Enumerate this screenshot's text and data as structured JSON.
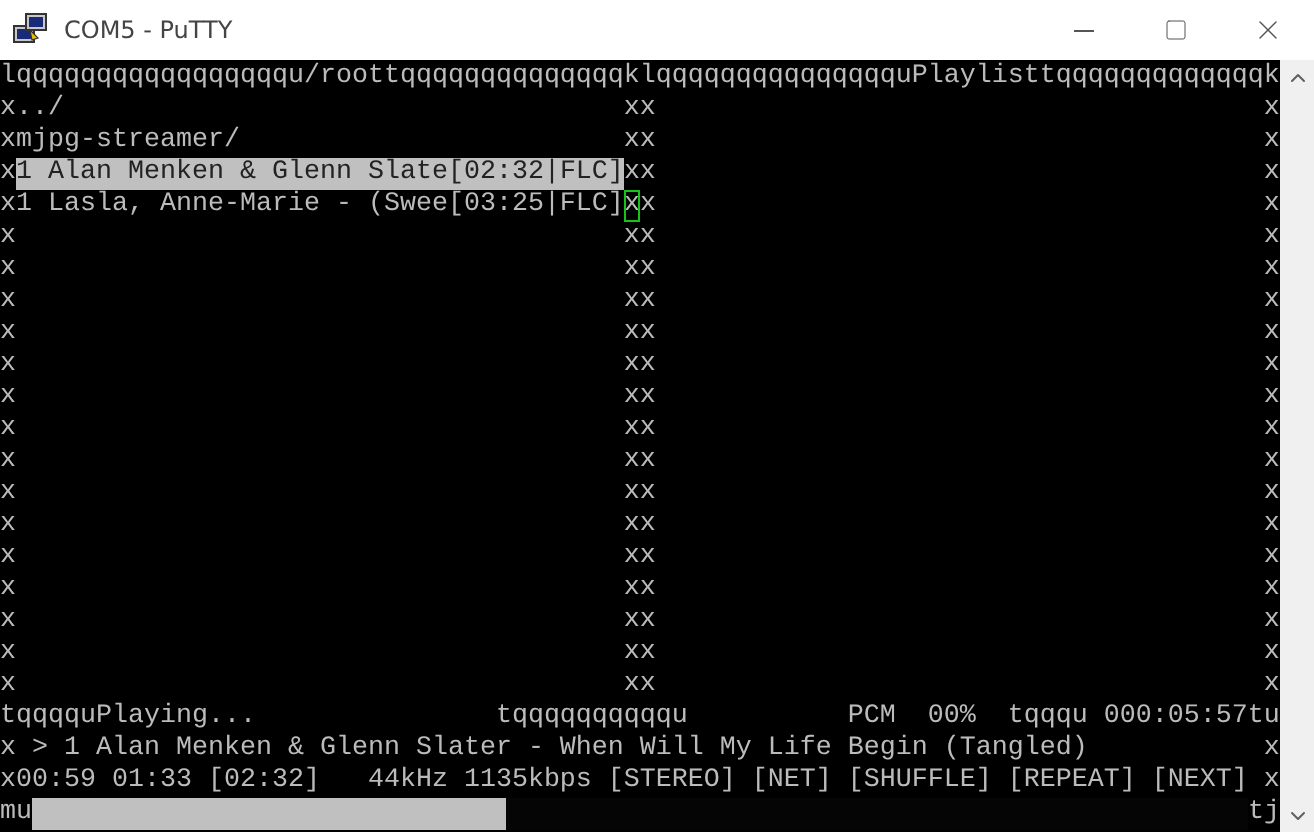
{
  "window": {
    "title": "COM5 - PuTTY"
  },
  "terminal": {
    "lines": [
      [
        {
          "kind": "text",
          "text": "lqqqqqqqqqqqqqqqqqu/roottqqqqqqqqqqqqqqklqqqqqqqqqqqqqqquPlaylisttqqqqqqqqqqqqqk"
        }
      ],
      [
        {
          "kind": "text",
          "text": "x../                                   xx                                      x"
        }
      ],
      [
        {
          "kind": "text",
          "text": "xmjpg-streamer/                        xx                                      x"
        }
      ],
      [
        {
          "kind": "text",
          "text": "x"
        },
        {
          "kind": "highlight",
          "text": "1 Alan Menken & Glenn Slate[02:32|FLC]"
        },
        {
          "kind": "text",
          "text": "xx                                      x"
        }
      ],
      [
        {
          "kind": "text",
          "text": "x1 Lasla, Anne-Marie - (Swee[03:25|FLC]"
        },
        {
          "kind": "cursor",
          "text": "x"
        },
        {
          "kind": "text",
          "text": "x                                      x"
        }
      ],
      [
        {
          "kind": "text",
          "text": "x                                      xx                                      x"
        }
      ],
      [
        {
          "kind": "text",
          "text": "x                                      xx                                      x"
        }
      ],
      [
        {
          "kind": "text",
          "text": "x                                      xx                                      x"
        }
      ],
      [
        {
          "kind": "text",
          "text": "x                                      xx                                      x"
        }
      ],
      [
        {
          "kind": "text",
          "text": "x                                      xx                                      x"
        }
      ],
      [
        {
          "kind": "text",
          "text": "x                                      xx                                      x"
        }
      ],
      [
        {
          "kind": "text",
          "text": "x                                      xx                                      x"
        }
      ],
      [
        {
          "kind": "text",
          "text": "x                                      xx                                      x"
        }
      ],
      [
        {
          "kind": "text",
          "text": "x                                      xx                                      x"
        }
      ],
      [
        {
          "kind": "text",
          "text": "x                                      xx                                      x"
        }
      ],
      [
        {
          "kind": "text",
          "text": "x                                      xx                                      x"
        }
      ],
      [
        {
          "kind": "text",
          "text": "x                                      xx                                      x"
        }
      ],
      [
        {
          "kind": "text",
          "text": "x                                      xx                                      x"
        }
      ],
      [
        {
          "kind": "text",
          "text": "x                                      xx                                      x"
        }
      ],
      [
        {
          "kind": "text",
          "text": "x                                      xx                                      x"
        }
      ],
      [
        {
          "kind": "text",
          "text": "tqqqquPlaying...               tqqqqqqqqqqu          PCM  00%  tqqqu 000:05:57tu"
        }
      ],
      [
        {
          "kind": "text",
          "text": "x > 1 Alan Menken & Glenn Slater - When Will My Life Begin (Tangled)           x"
        }
      ],
      [
        {
          "kind": "text",
          "text": "x00:59 01:33 [02:32]   44kHz 1135kbps [STEREO] [NET] [SHUFFLE] [REPEAT] [NEXT] x"
        }
      ]
    ],
    "progress": {
      "left": "mu",
      "right": "tj",
      "level": 0.39
    }
  }
}
